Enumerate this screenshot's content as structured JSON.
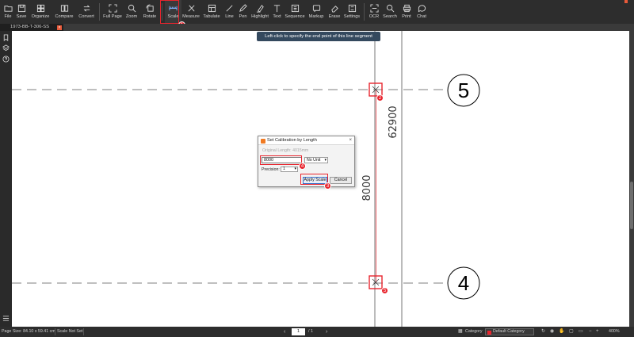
{
  "toolbar": {
    "buttons": [
      {
        "label": "File",
        "icon": "folder-icon"
      },
      {
        "label": "Save",
        "icon": "save-icon"
      },
      {
        "label": "Organize",
        "icon": "organize-icon"
      },
      {
        "label": "Compare",
        "icon": "compare-icon"
      },
      {
        "label": "Convert",
        "icon": "convert-icon"
      },
      {
        "label": "Full Page",
        "icon": "fullscreen-icon"
      },
      {
        "label": "Zoom",
        "icon": "zoom-icon"
      },
      {
        "label": "Rotate",
        "icon": "rotate-icon"
      },
      {
        "label": "Scale",
        "icon": "scale-icon"
      },
      {
        "label": "Measure",
        "icon": "measure-icon"
      },
      {
        "label": "Tabulate",
        "icon": "tabulate-icon"
      },
      {
        "label": "Line",
        "icon": "line-icon"
      },
      {
        "label": "Pen",
        "icon": "pen-icon"
      },
      {
        "label": "Highlight",
        "icon": "highlight-icon"
      },
      {
        "label": "Text",
        "icon": "text-icon"
      },
      {
        "label": "Sequence",
        "icon": "sequence-icon"
      },
      {
        "label": "Markup",
        "icon": "markup-icon"
      },
      {
        "label": "Erase",
        "icon": "erase-icon"
      },
      {
        "label": "Settings",
        "icon": "settings-icon"
      },
      {
        "label": "OCR",
        "icon": "ocr-icon"
      },
      {
        "label": "Search",
        "icon": "search-icon"
      },
      {
        "label": "Print",
        "icon": "print-icon"
      },
      {
        "label": "Chat",
        "icon": "chat-icon"
      }
    ]
  },
  "tab": {
    "label": "1973-BB-T-306-SS",
    "close": "×"
  },
  "tooltip": "Left-click to specify the end point of this line segment",
  "drawing": {
    "grid_label_top": "5",
    "grid_label_bottom": "4",
    "dim_overall": "62900",
    "dim_segment": "8000"
  },
  "dialog": {
    "title": "Set Calibration by Length",
    "close": "×",
    "original_length": "Original Length: 4015mm",
    "length_value": "8000",
    "unit": "No Unit",
    "precision_label": "Precision:",
    "precision_value": "1",
    "apply": "Apply Scale",
    "cancel": "Cancel"
  },
  "badges": {
    "b1": "1",
    "b2": "2",
    "b3": "3",
    "b4": "4",
    "b5": "5"
  },
  "status": {
    "page_size": "Page Size: 84.10 x 59.41 cm",
    "scale": "Scale Not Set",
    "current_page": "1",
    "total_pages": "/ 1",
    "category_label": "Category",
    "category_value": "Default Category",
    "zoom": "400%"
  },
  "colors": {
    "accent": "#f39c12",
    "annotation_red": "#e8242d",
    "tooltip_bg": "#34495e"
  }
}
